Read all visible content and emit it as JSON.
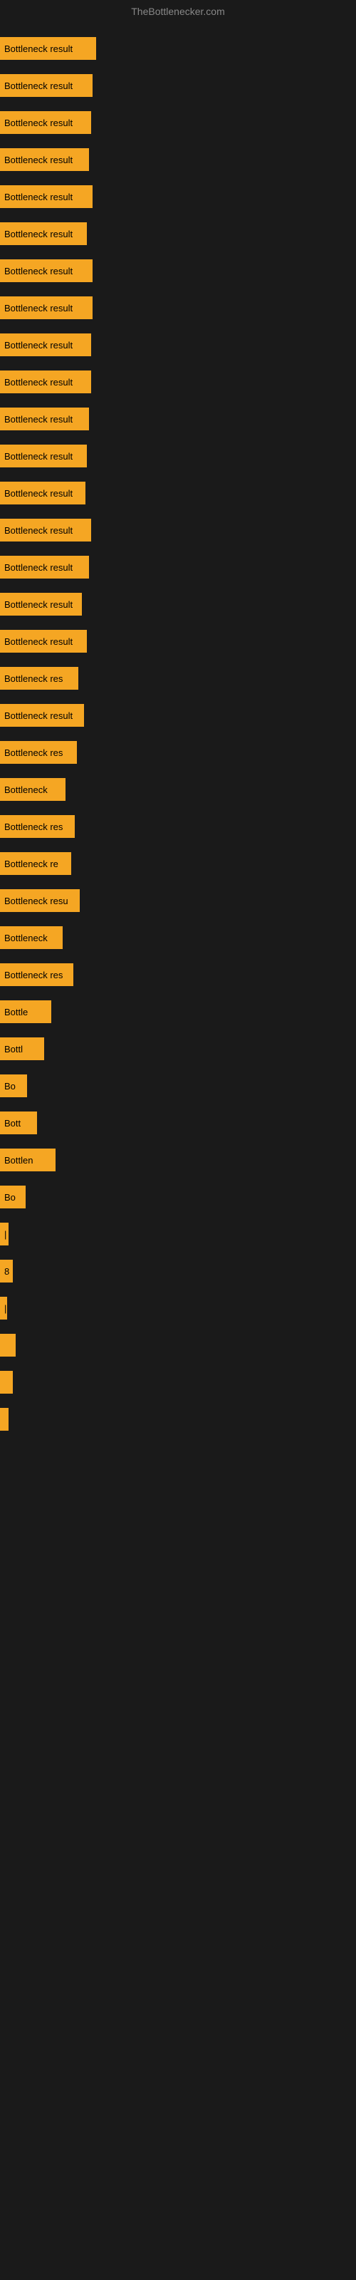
{
  "site": {
    "title": "TheBottlenecker.com"
  },
  "bars": [
    {
      "label": "Bottleneck result",
      "width": 135
    },
    {
      "label": "Bottleneck result",
      "width": 130
    },
    {
      "label": "Bottleneck result",
      "width": 128
    },
    {
      "label": "Bottleneck result",
      "width": 125
    },
    {
      "label": "Bottleneck result",
      "width": 130
    },
    {
      "label": "Bottleneck result",
      "width": 122
    },
    {
      "label": "Bottleneck result",
      "width": 130
    },
    {
      "label": "Bottleneck result",
      "width": 130
    },
    {
      "label": "Bottleneck result",
      "width": 128
    },
    {
      "label": "Bottleneck result",
      "width": 128
    },
    {
      "label": "Bottleneck result",
      "width": 125
    },
    {
      "label": "Bottleneck result",
      "width": 122
    },
    {
      "label": "Bottleneck result",
      "width": 120
    },
    {
      "label": "Bottleneck result",
      "width": 128
    },
    {
      "label": "Bottleneck result",
      "width": 125
    },
    {
      "label": "Bottleneck result",
      "width": 115
    },
    {
      "label": "Bottleneck result",
      "width": 122
    },
    {
      "label": "Bottleneck res",
      "width": 110
    },
    {
      "label": "Bottleneck result",
      "width": 118
    },
    {
      "label": "Bottleneck res",
      "width": 108
    },
    {
      "label": "Bottleneck",
      "width": 92
    },
    {
      "label": "Bottleneck res",
      "width": 105
    },
    {
      "label": "Bottleneck re",
      "width": 100
    },
    {
      "label": "Bottleneck resu",
      "width": 112
    },
    {
      "label": "Bottleneck",
      "width": 88
    },
    {
      "label": "Bottleneck res",
      "width": 103
    },
    {
      "label": "Bottle",
      "width": 72
    },
    {
      "label": "Bottl",
      "width": 62
    },
    {
      "label": "Bo",
      "width": 38
    },
    {
      "label": "Bott",
      "width": 52
    },
    {
      "label": "Bottlen",
      "width": 78
    },
    {
      "label": "Bo",
      "width": 36
    },
    {
      "label": "|",
      "width": 12
    },
    {
      "label": "8",
      "width": 18
    },
    {
      "label": "|",
      "width": 10
    },
    {
      "label": "",
      "width": 22
    },
    {
      "label": "",
      "width": 18
    },
    {
      "label": "",
      "width": 12
    }
  ]
}
